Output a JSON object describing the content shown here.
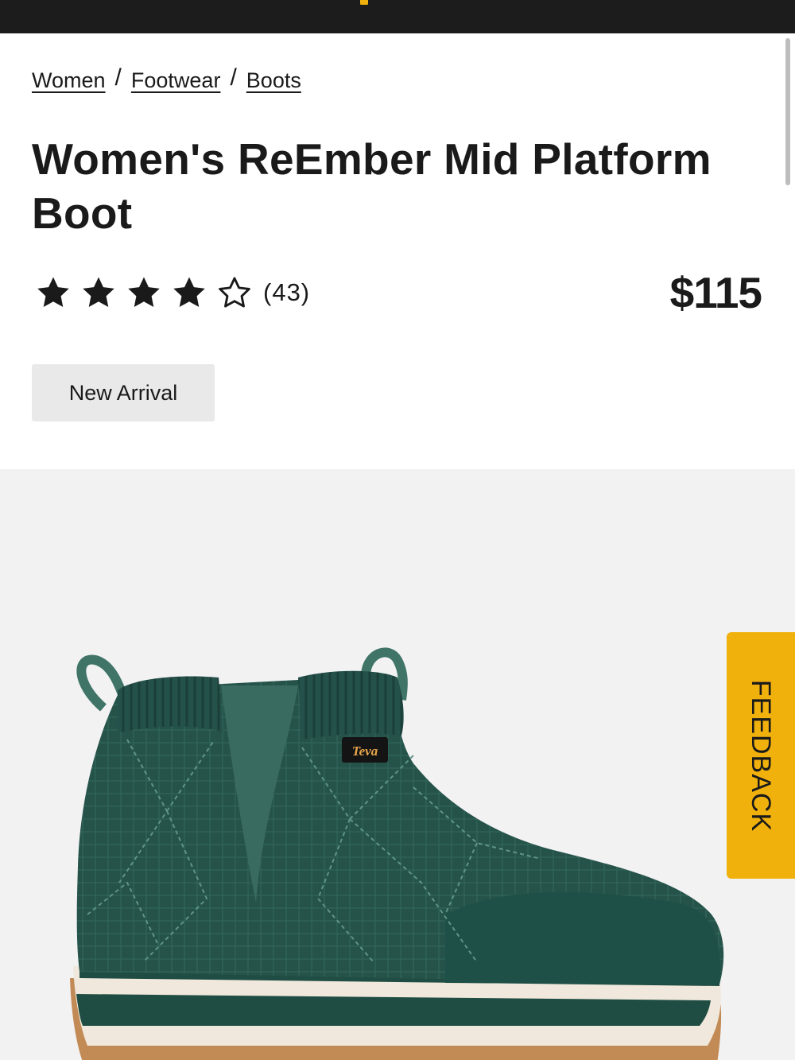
{
  "breadcrumb": {
    "items": [
      "Women",
      "Footwear",
      "Boots"
    ],
    "separator": "/"
  },
  "product": {
    "title": "Women's ReEmber Mid Platform Boot",
    "rating": 4,
    "rating_max": 5,
    "review_count": "(43)",
    "price": "$115",
    "badge": "New Arrival",
    "image_logo_text": "Teva"
  },
  "feedback": {
    "label": "FEEDBACK"
  },
  "colors": {
    "header_bg": "#1c1c1c",
    "brand_yellow": "#f1b10d",
    "boot_green": "#234d45",
    "image_bg": "#f2f2f2"
  },
  "icons": {
    "star_filled": "star-filled-icon",
    "star_empty": "star-outline-icon"
  }
}
